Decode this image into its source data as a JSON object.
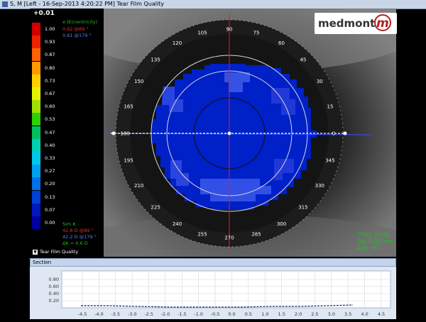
{
  "window": {
    "title": "S, M [Left - 16-Sep-2013 4:20:22 PM] Tear Film Quality"
  },
  "scale": {
    "top_value": "+0.01",
    "levels": [
      {
        "label": "1.00",
        "color": "#d00000"
      },
      {
        "label": "0.93",
        "color": "#f02000"
      },
      {
        "label": "0.87",
        "color": "#ff6000"
      },
      {
        "label": "0.80",
        "color": "#ff9a00"
      },
      {
        "label": "0.73",
        "color": "#ffd000"
      },
      {
        "label": "0.67",
        "color": "#e8f000"
      },
      {
        "label": "0.60",
        "color": "#a0e000"
      },
      {
        "label": "0.53",
        "color": "#30d000"
      },
      {
        "label": "0.47",
        "color": "#00c060"
      },
      {
        "label": "0.40",
        "color": "#00d0b0"
      },
      {
        "label": "0.33",
        "color": "#00c8e8"
      },
      {
        "label": "0.27",
        "color": "#00a0f0"
      },
      {
        "label": "0.20",
        "color": "#0070e8"
      },
      {
        "label": "0.13",
        "color": "#0040d8"
      },
      {
        "label": "0.07",
        "color": "#0018c0"
      },
      {
        "label": "0.00",
        "color": "#0000a0"
      }
    ]
  },
  "eccentricity": {
    "title": "e (Eccentricity)",
    "value1": "0.62 @89 °",
    "value2": "0.61 @179 °"
  },
  "simk": {
    "title": "Sim K",
    "value1": "42.8 D @89 °",
    "value2": "42.2 D @179 °",
    "delta": "ΔK = 0.6 D"
  },
  "mode_select": {
    "label": "Tear Film Quality"
  },
  "logo": {
    "text": "medmont",
    "mark": "m"
  },
  "metrics": {
    "tfsq": "TFSQ: 0.030",
    "dis": "Dis: 0.02 mm",
    "ang": "Ang: 90°"
  },
  "axis_labels": [
    "90",
    "75",
    "60",
    "45",
    "30",
    "15",
    "0",
    "345",
    "330",
    "315",
    "300",
    "285",
    "270",
    "255",
    "240",
    "225",
    "210",
    "195",
    "180",
    "165",
    "150",
    "135",
    "120",
    "105"
  ],
  "section": {
    "title": "Section",
    "y_ticks": [
      "0.80",
      "0.60",
      "0.40",
      "0.20"
    ],
    "x_ticks": [
      "-4.5",
      "-4.0",
      "-3.5",
      "-3.0",
      "-2.5",
      "-2.0",
      "-1.5",
      "-1.0",
      "-0.5",
      "0.0",
      "0.5",
      "1.0",
      "1.5",
      "2.0",
      "2.5",
      "3.0",
      "3.5",
      "4.0",
      "4.5"
    ]
  },
  "colors": {
    "map_blue": "#0020c8",
    "map_blue_light": "#3050e0",
    "section_line": "#102070",
    "meridian_red": "#e02020",
    "metric_green": "#20c020"
  }
}
